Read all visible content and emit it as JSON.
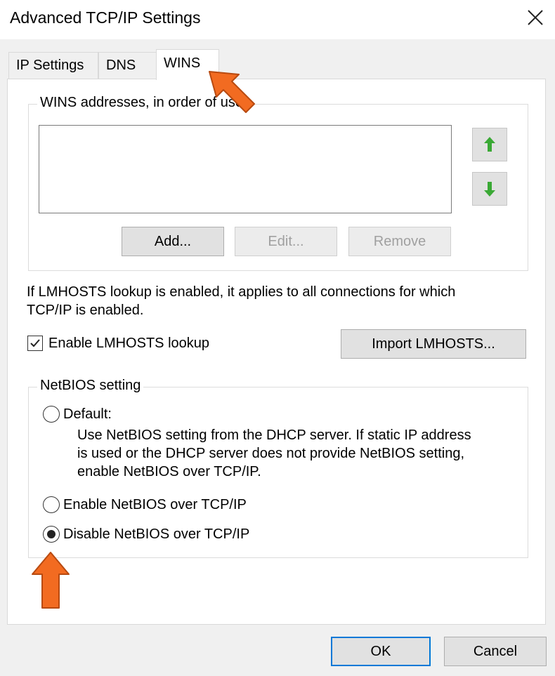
{
  "window": {
    "title": "Advanced TCP/IP Settings",
    "close_icon": "close-icon"
  },
  "tabs": [
    {
      "label": "IP Settings",
      "active": false
    },
    {
      "label": "DNS",
      "active": false
    },
    {
      "label": "WINS",
      "active": true
    }
  ],
  "wins": {
    "group_label": "WINS addresses, in order of use:",
    "addresses": [],
    "move_up_icon": "arrow-up-icon",
    "move_down_icon": "arrow-down-icon",
    "add_label": "Add...",
    "edit_label": "Edit...",
    "remove_label": "Remove"
  },
  "lmhosts": {
    "info_line1": "If LMHOSTS lookup is enabled, it applies to all connections for which",
    "info_line2": "TCP/IP is enabled.",
    "checkbox_label": "Enable LMHOSTS lookup",
    "checked": true,
    "import_label": "Import LMHOSTS..."
  },
  "netbios": {
    "group_label": "NetBIOS setting",
    "default_label": "Default:",
    "default_desc_line1": "Use NetBIOS setting from the DHCP server. If static IP address",
    "default_desc_line2": "is used or the DHCP server does not provide NetBIOS setting,",
    "default_desc_line3": "enable NetBIOS over TCP/IP.",
    "enable_label": "Enable NetBIOS over TCP/IP",
    "disable_label": "Disable NetBIOS over TCP/IP",
    "selected": "disable"
  },
  "footer": {
    "ok_label": "OK",
    "cancel_label": "Cancel"
  },
  "colors": {
    "accent": "#0078d7",
    "callout_arrow": "#f26b21",
    "move_arrow": "#3aa935"
  }
}
